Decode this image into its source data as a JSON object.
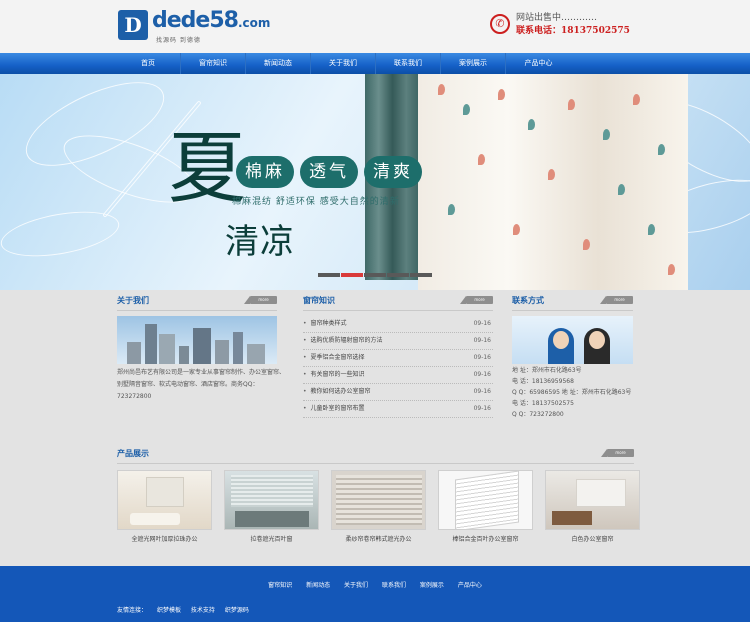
{
  "header": {
    "logo_mark": "D",
    "logo_text": "dede",
    "logo_num": "58",
    "logo_domain": ".com",
    "slogan": "找源码 到德德",
    "sale_text": "网站出售中…………",
    "tel_text": "联系电话：18137502575",
    "icon": "phone-icon"
  },
  "nav": {
    "items": [
      "首页",
      "窗帘知识",
      "新闻动态",
      "关于我们",
      "联系我们",
      "案例展示",
      "产品中心"
    ]
  },
  "banner": {
    "big_char": "夏",
    "qingliang": "清凉",
    "badges": [
      "棉麻",
      "透气",
      "清爽"
    ],
    "subtitle": "棉麻混纺 舒适环保 感受大自然的清新"
  },
  "about": {
    "title": "关于我们",
    "more": "more",
    "text": "郑州尚邑布艺有限公司是一家专业从事窗帘制作、办公室窗帘、别墅隔音窗帘、软式电动窗帘、酒店窗帘。商务QQ：723272800"
  },
  "news": {
    "title": "窗帘知识",
    "more": "more",
    "items": [
      {
        "title": "窗帘种类样式",
        "date": "09-16"
      },
      {
        "title": "选购优质防辐射窗帘的方法",
        "date": "09-16"
      },
      {
        "title": "夏季铝合金窗帘选择",
        "date": "09-16"
      },
      {
        "title": "有关窗帘的一些知识",
        "date": "09-16"
      },
      {
        "title": "教你如何选办公室窗帘",
        "date": "09-16"
      },
      {
        "title": "儿童卧室的窗帘布置",
        "date": "09-16"
      }
    ]
  },
  "contact": {
    "title": "联系方式",
    "more": "more",
    "lines": [
      "地 址：郑州市石化路63号",
      "电 话：18136959568",
      "Q Q：65986595 地 址：郑州市石化路63号",
      "电 话：18137502575",
      "Q Q：723272800"
    ]
  },
  "products": {
    "title": "产品展示",
    "more": "more",
    "items": [
      {
        "caption": "全遮光网叶加厚拉珠办公"
      },
      {
        "caption": "拉卷遮光百叶窗"
      },
      {
        "caption": "柔纱帘卷帘韩式遮光办公"
      },
      {
        "caption": "棒铝合金百叶办公室窗帘"
      },
      {
        "caption": "白色办公室窗帘"
      }
    ]
  },
  "footer": {
    "nav": [
      "窗帘知识",
      "新闻动态",
      "关于我们",
      "联系我们",
      "案例展示",
      "产品中心"
    ],
    "links_label": "友情连接：",
    "links": [
      "织梦模板",
      "技术支持",
      "织梦源码"
    ]
  },
  "colors": {
    "brand_blue": "#1d5fa8",
    "nav_blue": "#1560c7",
    "footer_blue": "#1457b8",
    "tel_red": "#cc1f1f",
    "banner_green": "#1d6e6b"
  }
}
